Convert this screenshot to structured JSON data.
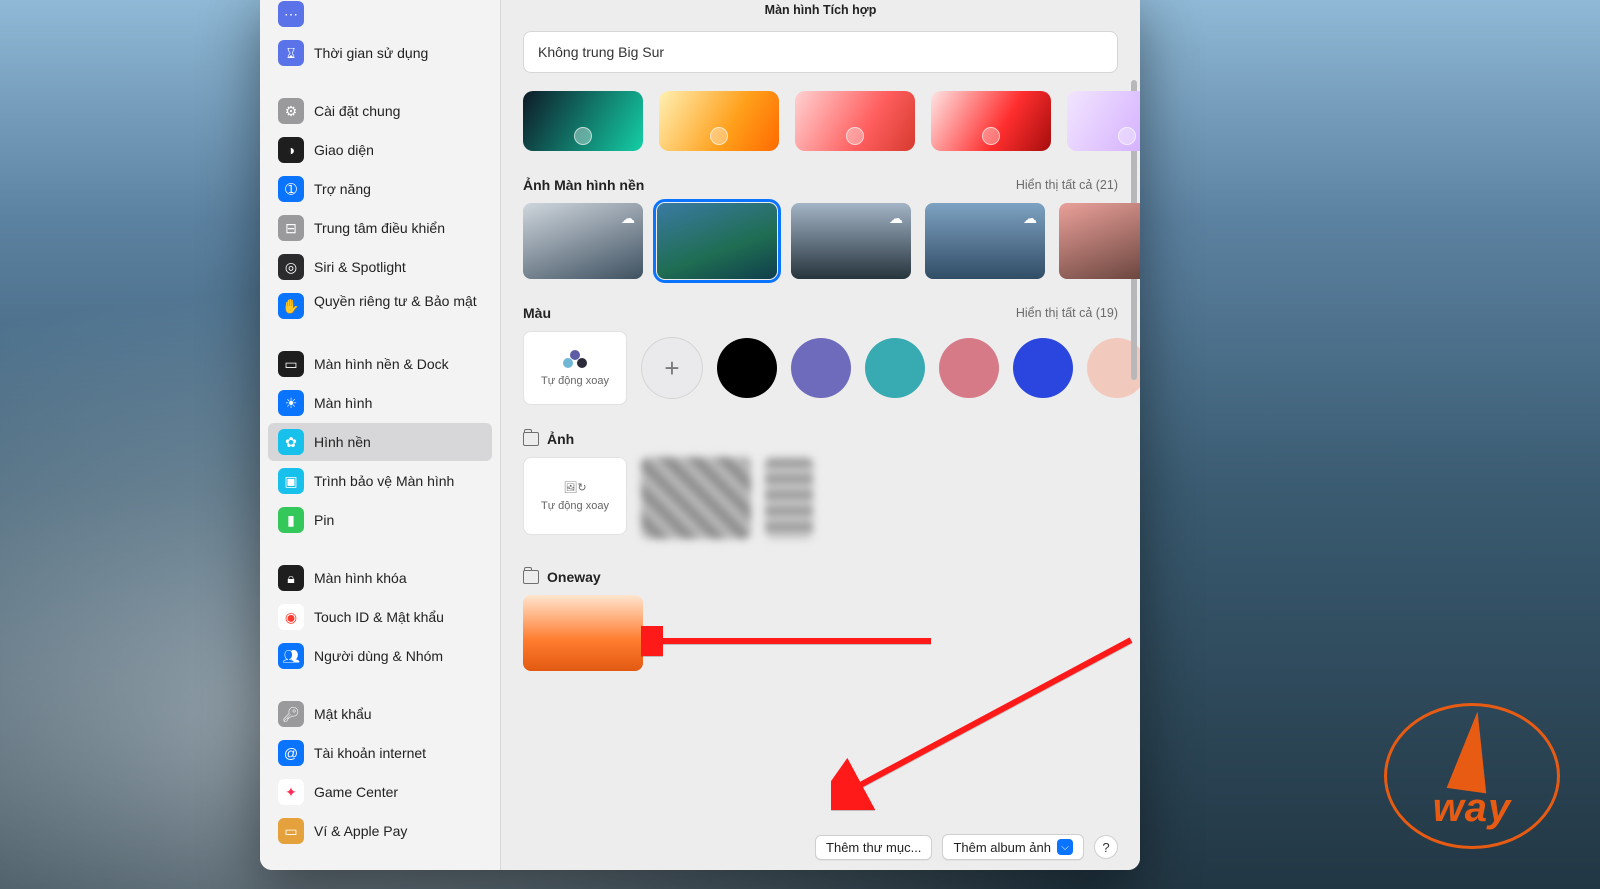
{
  "preview": {
    "display_label": "Màn hình Tích hợp"
  },
  "current_wallpaper": {
    "name": "Không trung Big Sur"
  },
  "accent_swatches": [
    {
      "gradient": "linear-gradient(120deg,#0e1a28 0%, #14cfa6 100%)"
    },
    {
      "gradient": "linear-gradient(120deg,#fff0b3 0%, #ff9f1a 60%, #ff6a00 100%)"
    },
    {
      "gradient": "linear-gradient(120deg,#ffd1d1 0%, #ff5f5f 60%, #d63a2e 100%)"
    },
    {
      "gradient": "linear-gradient(120deg,#ffe4e4 0%, #ff2e2e 60%, #a50d0d 100%)"
    },
    {
      "gradient": "linear-gradient(120deg,#f2e5ff 0%, #c99cff 100%)"
    }
  ],
  "sections": {
    "wallpapers": {
      "title": "Ảnh Màn hình nền",
      "show_all": "Hiển thị tất cả (21)",
      "thumbs": [
        {
          "bg": "linear-gradient(160deg,#cfd6dd 0%,#3f5161 100%)",
          "download": true
        },
        {
          "bg": "linear-gradient(160deg,#3a7aa3 0%, #1f6d52 60%, #0f3e4c 100%)",
          "selected": true
        },
        {
          "bg": "linear-gradient(180deg,#a3b4c6 0%, #26343d 100%)",
          "download": true
        },
        {
          "bg": "linear-gradient(180deg,#7ea2c2 0%, #314d66 100%)",
          "download": true
        },
        {
          "bg": "linear-gradient(160deg,#eaa09a 0%, #5b3b33 100%)"
        }
      ]
    },
    "colors": {
      "title": "Màu",
      "show_all": "Hiển thị tất cả (19)",
      "auto_label": "Tự động xoay",
      "swatches": [
        "#000000",
        "#6e6bbd",
        "#38aab2",
        "#d77a87",
        "#2a46de",
        "#f2c9bd"
      ]
    },
    "photos": {
      "title": "Ảnh",
      "auto_label": "Tự động xoay"
    },
    "custom_folder": {
      "title": "Oneway"
    }
  },
  "footer": {
    "add_folder": "Thêm thư mục...",
    "add_album": "Thêm album ảnh",
    "help": "?"
  },
  "sidebar": [
    {
      "label": "",
      "icon_bg": "#5b73e8",
      "icon": "⋯",
      "name": "sidebar-item-partial-top"
    },
    {
      "label": "Thời gian sử dụng",
      "icon_bg": "#5b73e8",
      "icon": "⌛︎",
      "name": "sidebar-item-screentime"
    },
    {
      "gap": true
    },
    {
      "label": "Cài đặt chung",
      "icon_bg": "#9a9a9c",
      "icon": "⚙︎",
      "name": "sidebar-item-general"
    },
    {
      "label": "Giao diện",
      "icon_bg": "#1e1e1e",
      "icon": "◑",
      "name": "sidebar-item-appearance"
    },
    {
      "label": "Trợ năng",
      "icon_bg": "#0a74ff",
      "icon": "➀",
      "name": "sidebar-item-accessibility"
    },
    {
      "label": "Trung tâm điều khiển",
      "icon_bg": "#9a9a9c",
      "icon": "⊟",
      "name": "sidebar-item-controlcenter"
    },
    {
      "label": "Siri & Spotlight",
      "icon_bg": "#2b2b2d",
      "icon": "◎",
      "name": "sidebar-item-siri"
    },
    {
      "label": "Quyền riêng tư & Bảo mật",
      "icon_bg": "#0a74ff",
      "icon": "✋",
      "name": "sidebar-item-privacy",
      "multiline": true
    },
    {
      "gap": true
    },
    {
      "label": "Màn hình nền & Dock",
      "icon_bg": "#1e1e1e",
      "icon": "▭",
      "name": "sidebar-item-desktopdock"
    },
    {
      "label": "Màn hình",
      "icon_bg": "#0a74ff",
      "icon": "☀︎",
      "name": "sidebar-item-displays"
    },
    {
      "label": "Hình nền",
      "icon_bg": "#18c1ec",
      "icon": "✿",
      "name": "sidebar-item-wallpaper",
      "selected": true
    },
    {
      "label": "Trình bảo vệ Màn hình",
      "icon_bg": "#18c1ec",
      "icon": "▣",
      "name": "sidebar-item-screensaver"
    },
    {
      "label": "Pin",
      "icon_bg": "#34c759",
      "icon": "▮",
      "name": "sidebar-item-battery"
    },
    {
      "gap": true
    },
    {
      "label": "Màn hình khóa",
      "icon_bg": "#1e1e1e",
      "icon": "🔒︎",
      "name": "sidebar-item-lockscreen"
    },
    {
      "label": "Touch ID & Mật khẩu",
      "icon_bg": "#ffffff",
      "icon": "◉",
      "icon_color": "#ff3b30",
      "name": "sidebar-item-touchid"
    },
    {
      "label": "Người dùng & Nhóm",
      "icon_bg": "#0a74ff",
      "icon": "👥︎",
      "name": "sidebar-item-users"
    },
    {
      "gap": true
    },
    {
      "label": "Mật khẩu",
      "icon_bg": "#9a9a9c",
      "icon": "🔑︎",
      "name": "sidebar-item-passwords"
    },
    {
      "label": "Tài khoản internet",
      "icon_bg": "#0a74ff",
      "icon": "@",
      "name": "sidebar-item-internetaccounts"
    },
    {
      "label": "Game Center",
      "icon_bg": "#ffffff",
      "icon": "✦",
      "icon_color": "#ff2d55",
      "name": "sidebar-item-gamecenter"
    },
    {
      "label": "Ví & Apple Pay",
      "icon_bg": "#e5a23c",
      "icon": "▭",
      "name": "sidebar-item-wallet"
    }
  ],
  "watermark": {
    "text": "way"
  }
}
